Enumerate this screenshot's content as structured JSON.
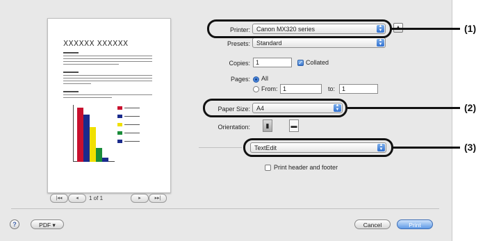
{
  "preview": {
    "doc_title": "XXXXXX XXXXXX",
    "page_indicator": "1 of 1",
    "nav_first": "|◂◂",
    "nav_prev": "◂",
    "nav_next": "▸",
    "nav_last": "▸▸|",
    "chart_colors": [
      "#c8102e",
      "#1a2b8c",
      "#f0e000",
      "#1a8c3a",
      "#1a2b8c"
    ]
  },
  "printer": {
    "label": "Printer:",
    "value": "Canon MX320 series"
  },
  "presets": {
    "label": "Presets:",
    "value": "Standard"
  },
  "copies": {
    "label": "Copies:",
    "value": "1",
    "collated_label": "Collated",
    "collated_checked": true
  },
  "pages": {
    "label": "Pages:",
    "all_label": "All",
    "from_label": "From:",
    "from_value": "1",
    "to_label": "to:",
    "to_value": "1"
  },
  "paper_size": {
    "label": "Paper Size:",
    "value": "A4"
  },
  "orientation": {
    "label": "Orientation:",
    "portrait_icon": "portrait-orientation-icon",
    "landscape_icon": "landscape-orientation-icon"
  },
  "section_popup": {
    "value": "TextEdit"
  },
  "header_footer": {
    "label": "Print header and footer",
    "checked": false
  },
  "footer": {
    "help_icon": "?",
    "pdf_label": "PDF ▾",
    "cancel_label": "Cancel",
    "print_label": "Print"
  },
  "callouts": [
    "(1)",
    "(2)",
    "(3)"
  ],
  "colors": {
    "accent": "#3b77cf",
    "highlight": "#111111"
  }
}
